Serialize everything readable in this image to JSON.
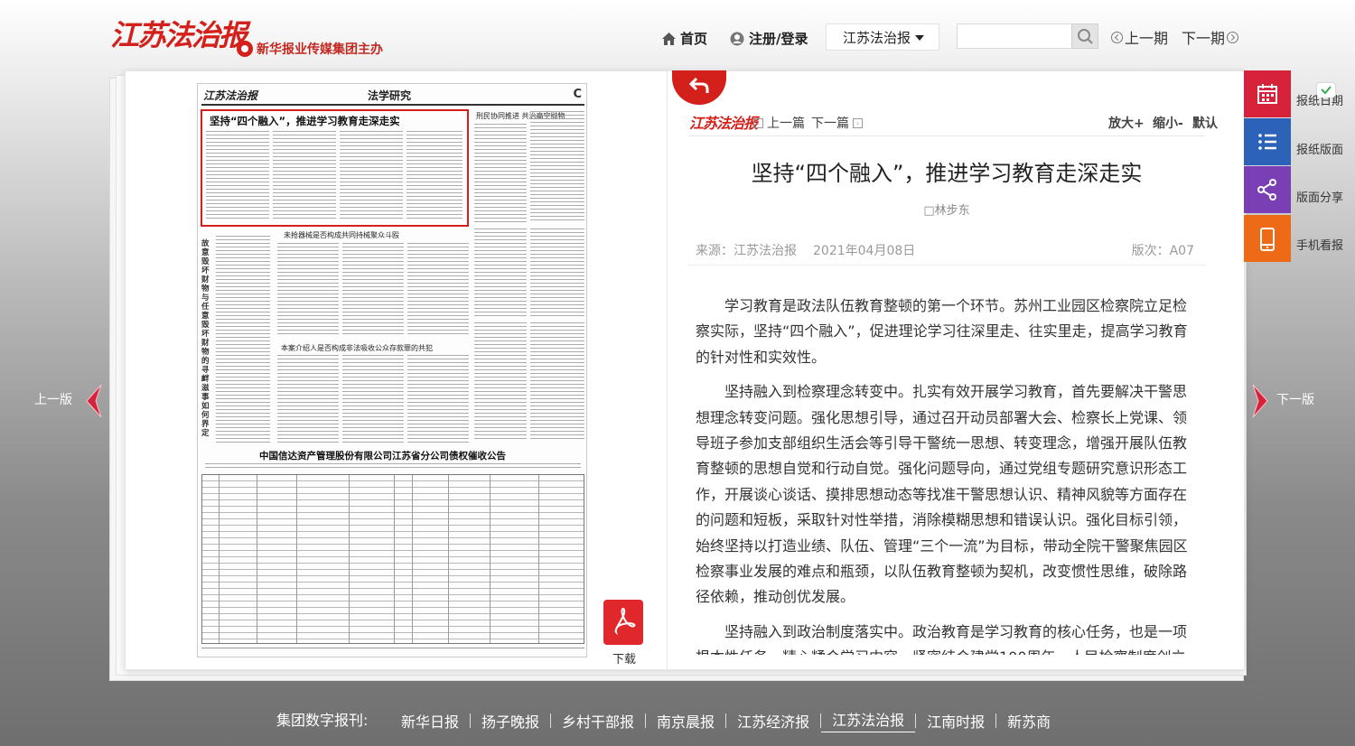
{
  "header": {
    "logo_text": "江苏法治报",
    "group_text": "新华报业传媒集团主办",
    "nav_home": "首页",
    "nav_login": "注册/登录",
    "paper_select": "江苏法治报",
    "search_placeholder": "",
    "prev_issue": "上一期",
    "next_issue": "下一期"
  },
  "newspaper": {
    "masthead": "江苏法治报",
    "section": "法学研究",
    "page_tag": "C",
    "headline": "坚持“四个融入”，推进学习教育走深走实",
    "sub_heading_1": "刑民协同推进 共治高空抛物",
    "sub_heading_2": "未抢器械是否构成共同持械聚众斗殴",
    "sub_heading_3": "本案介绍人是否构成非法吸收公众存款罪的共犯",
    "side_title": "故意毁坏财物与任意毁坏财物的寻衅滋事如何界定",
    "notice_title": "中国信达资产管理股份有限公司江苏省分公司债权催收公告"
  },
  "download": {
    "label": "下载"
  },
  "article": {
    "masthead": "江苏法治报",
    "prev": "上一篇",
    "next": "下一篇",
    "zoom_in": "放大+",
    "zoom_out": "缩小-",
    "zoom_default": "默认",
    "title": "坚持“四个融入”，推进学习教育走深走实",
    "author": "□林步东",
    "source": "来源：江苏法治报",
    "date": "2021年04月08日",
    "version": "版次：A07",
    "paragraphs": [
      "学习教育是政法队伍教育整顿的第一个环节。苏州工业园区检察院立足检察实际，坚持“四个融入”，促进理论学习往深里走、往实里走，提高学习教育的针对性和实效性。",
      "坚持融入到检察理念转变中。扎实有效开展学习教育，首先要解决干警思想理念转变问题。强化思想引导，通过召开动员部署大会、检察长上党课、领导班子参加支部组织生活会等引导干警统一思想、转变理念，增强开展队伍教育整顿的思想自觉和行动自觉。强化问题导向，通过党组专题研究意识形态工作，开展谈心谈话、摸排思想动态等找准干警思想认识、精神风貌等方面存在的问题和短板，采取针对性举措，消除模糊思想和错误认识。强化目标引领，始终坚持以打造业绩、队伍、管理“三个一流”为目标，带动全院干警聚焦园区检察事业发展的难点和瓶颈，以队伍教育整顿为契机，改变惯性思维，破除路径依赖，推动创优发展。",
      "坚持融入到政治制度落实中。政治教育是学习教育的核心任务，也是一项根本性任务。精心糅合学习内容，紧密结合建党100周年、人民检察制度创立90周年等重大主题，通过组织参观李强革命展示馆、观看红色电影、聆听“延安整风”专题"
    ]
  },
  "paging": {
    "prev_page": "上一版",
    "next_page": "下一版"
  },
  "sidebar": {
    "items": [
      {
        "label": "报纸日期",
        "icon": "calendar-icon",
        "color": "#d6223a"
      },
      {
        "label": "报纸版面",
        "icon": "list-icon",
        "color": "#2c63b9"
      },
      {
        "label": "版面分享",
        "icon": "share-icon",
        "color": "#7a3fb4"
      },
      {
        "label": "手机看报",
        "icon": "mobile-icon",
        "color": "#ef6a16"
      }
    ]
  },
  "footer": {
    "label": "集团数字报刊:",
    "links": [
      "新华日报",
      "扬子晚报",
      "乡村干部报",
      "南京晨报",
      "江苏经济报",
      "江苏法治报",
      "江南时报",
      "新苏商"
    ],
    "active": "江苏法治报"
  },
  "colors": {
    "brand_red": "#d3201b",
    "calendar_red": "#d6223a",
    "list_blue": "#2c63b9",
    "share_purple": "#7a3fb4",
    "mobile_orange": "#ef6a16"
  }
}
